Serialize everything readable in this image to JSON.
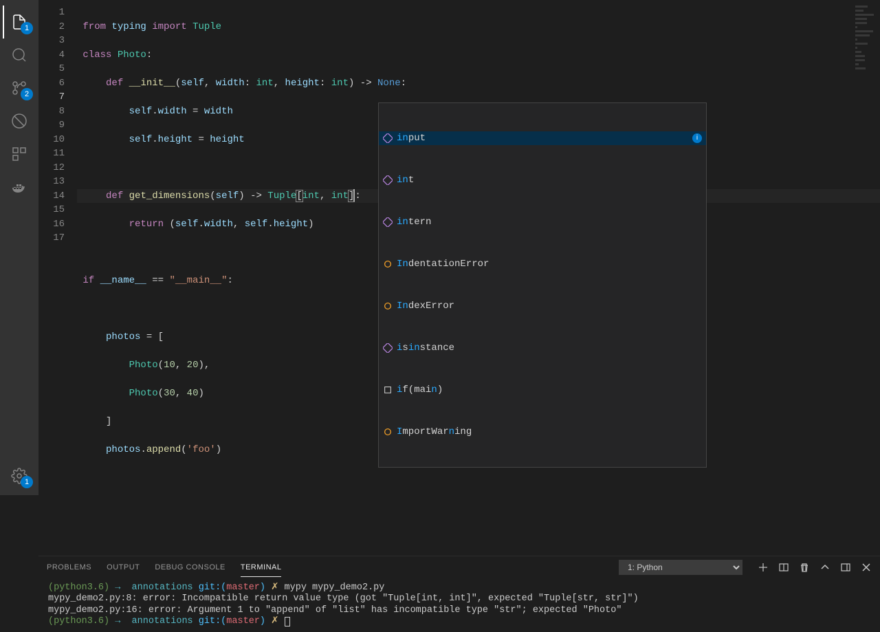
{
  "activity": {
    "files_badge": "1",
    "scm_badge": "2",
    "gear_badge": "1"
  },
  "code": {
    "lines": 17,
    "active_line": 7,
    "l1": {
      "from": "from",
      "typing": "typing",
      "import": "import",
      "Tuple": "Tuple"
    },
    "l2": {
      "class": "class",
      "Photo": "Photo"
    },
    "l3": {
      "def": "def",
      "init": "__init__",
      "self": "self",
      "width": "width",
      "int1": "int",
      "height": "height",
      "int2": "int",
      "None": "None"
    },
    "l4": {
      "self": "self",
      "width": "width",
      "eq": " = ",
      "widthv": "width"
    },
    "l5": {
      "self": "self",
      "height": "height",
      "eq": " = ",
      "heightv": "height"
    },
    "l7": {
      "def": "def",
      "fn": "get_dimensions",
      "self": "self",
      "Tuple": "Tuple",
      "int1": "int",
      "int2": "int"
    },
    "l8": {
      "return": "return",
      "self1": "self",
      "width": "width",
      "self2": "self",
      "height": "height"
    },
    "l10": {
      "if": "if",
      "name": "__name__",
      "main": "\"__main__\""
    },
    "l12": {
      "photos": "photos"
    },
    "l13": {
      "Photo": "Photo",
      "a": "10",
      "b": "20"
    },
    "l14": {
      "Photo": "Photo",
      "a": "30",
      "b": "40"
    },
    "l16": {
      "photos": "photos",
      "append": "append",
      "foo": "'foo'"
    }
  },
  "autocomplete": {
    "items": [
      {
        "label": "input",
        "hl": "in",
        "rest": "put",
        "kind": "fn",
        "selected": true,
        "info": true
      },
      {
        "label": "int",
        "hl": "in",
        "rest": "t",
        "kind": "cls"
      },
      {
        "label": "intern",
        "hl": "in",
        "rest": "tern",
        "kind": "fn"
      },
      {
        "label": "IndentationError",
        "hl": "In",
        "rest": "dentationError",
        "kind": "cls-y"
      },
      {
        "label": "IndexError",
        "hl": "In",
        "rest": "dexError",
        "kind": "cls-y"
      },
      {
        "label": "isinstance",
        "hl_parts": [
          "isi",
          "n",
          "sta",
          "n",
          "ce"
        ],
        "kind": "fn"
      },
      {
        "label": "if(main)",
        "pre": "i",
        "hl": "",
        "rest": "f(mai",
        "hl2": "n",
        "rest2": ")",
        "kind": "snippet"
      },
      {
        "label": "ImportWarning",
        "pre": "I",
        "rest": "mportWar",
        "hl2": "n",
        "rest2": "ing",
        "kind": "cls-y"
      }
    ]
  },
  "panel": {
    "tabs": {
      "problems": "PROBLEMS",
      "output": "OUTPUT",
      "debug": "DEBUG CONSOLE",
      "terminal": "TERMINAL"
    },
    "select": "1: Python",
    "term_line1": {
      "env": "(python3.6)",
      "arrow": "→",
      "folder": "annotations",
      "git": "git:(",
      "branch": "master",
      "close": ")",
      "x": "✗",
      "cmd": "mypy mypy_demo2.py"
    },
    "term_line2": "mypy_demo2.py:8: error: Incompatible return value type (got \"Tuple[int, int]\", expected \"Tuple[str, str]\")",
    "term_line3": "mypy_demo2.py:16: error: Argument 1 to \"append\" of \"list\" has incompatible type \"str\"; expected \"Photo\"",
    "term_line4": {
      "env": "(python3.6)",
      "arrow": "→",
      "folder": "annotations",
      "git": "git:(",
      "branch": "master",
      "close": ")",
      "x": "✗"
    }
  }
}
